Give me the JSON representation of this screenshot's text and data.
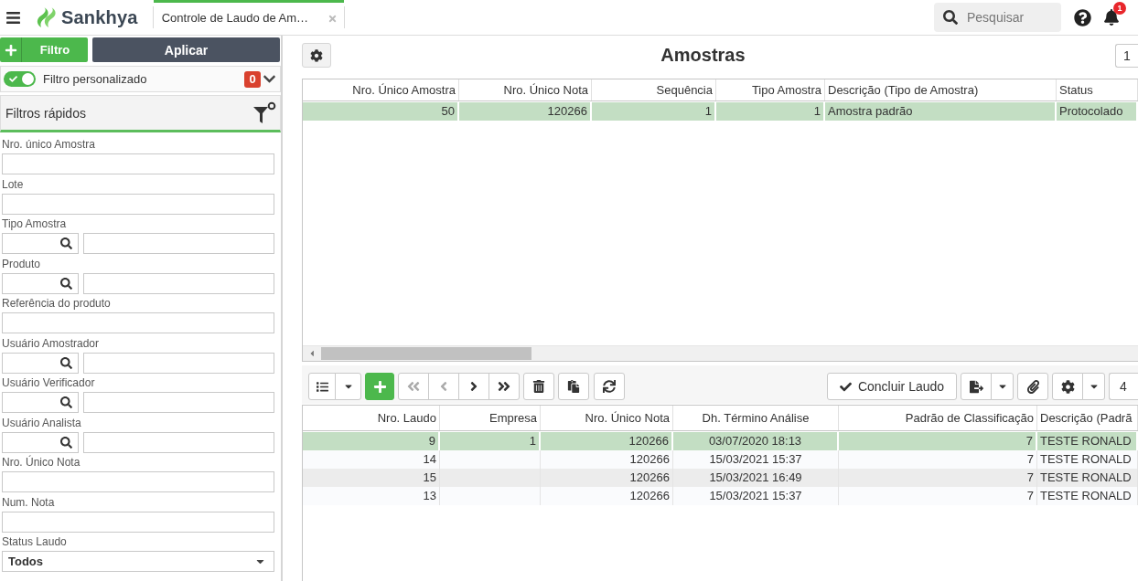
{
  "top_bar": {
    "logo": "Sankhya",
    "tab": {
      "label": "Controle de Laudo de Am…",
      "selected": true
    },
    "search": {
      "placeholder": "Pesquisar"
    },
    "notifications": {
      "count": "1"
    }
  },
  "filter_panel": {
    "add_button": "Filtro",
    "apply_button": "Aplicar",
    "custom_filter": {
      "label": "Filtro personalizado",
      "on": true,
      "count": "0"
    },
    "quick_filters": {
      "title": "Filtros rápidos",
      "fields": [
        {
          "label": "Nro. único Amostra",
          "kind": "text"
        },
        {
          "label": "Lote",
          "kind": "text"
        },
        {
          "label": "Tipo Amostra",
          "kind": "lookup"
        },
        {
          "label": "Produto",
          "kind": "lookup"
        },
        {
          "label": "Referência do produto",
          "kind": "text"
        },
        {
          "label": "Usuário Amostrador",
          "kind": "lookup"
        },
        {
          "label": "Usuário Verificador",
          "kind": "lookup"
        },
        {
          "label": "Usuário Analista",
          "kind": "lookup"
        },
        {
          "label": "Nro. Único Nota",
          "kind": "text"
        },
        {
          "label": "Num. Nota",
          "kind": "text"
        },
        {
          "label": "Status Laudo",
          "kind": "select",
          "value": "Todos"
        }
      ]
    }
  },
  "samples": {
    "title": "Amostras",
    "page": "1",
    "table": {
      "columns": [
        {
          "label": "Nro. Único Amostra",
          "kind": "number"
        },
        {
          "label": "Nro. Único Nota",
          "kind": "number"
        },
        {
          "label": "Sequência",
          "kind": "number"
        },
        {
          "label": "Tipo Amostra",
          "kind": "number"
        },
        {
          "label": "Descrição (Tipo de Amostra)",
          "kind": "text"
        },
        {
          "label": "Status",
          "kind": "text"
        }
      ],
      "rows": [
        {
          "selected": true,
          "cells": [
            "50",
            "120266",
            "1",
            "1",
            "Amostra padrão",
            "Protocolado"
          ]
        }
      ]
    }
  },
  "reports": {
    "toolbar": {
      "nav_buttons": [
        {
          "kind": "first",
          "disabled": true
        },
        {
          "kind": "previous",
          "disabled": true
        },
        {
          "kind": "next",
          "disabled": false
        },
        {
          "kind": "last",
          "disabled": false
        }
      ],
      "complete_button": "Concluir Laudo"
    },
    "page": "4",
    "table": {
      "columns": [
        {
          "label": "Nro. Laudo",
          "kind": "number"
        },
        {
          "label": "Empresa",
          "kind": "number"
        },
        {
          "label": "Nro. Único Nota",
          "kind": "number"
        },
        {
          "label": "Dh. Término Análise",
          "kind": "date"
        },
        {
          "label": "Padrão de Classificação",
          "kind": "number"
        },
        {
          "label": "Descrição (Padrã",
          "kind": "text"
        }
      ],
      "rows": [
        {
          "selected": true,
          "cells": [
            "9",
            "1",
            "120266",
            "03/07/2020 18:13",
            "7",
            "TESTE RONALD"
          ]
        },
        {
          "selected": false,
          "cells": [
            "14",
            null,
            "120266",
            "15/03/2021 15:37",
            "7",
            "TESTE RONALD"
          ]
        },
        {
          "selected": false,
          "cells": [
            "15",
            null,
            "120266",
            "15/03/2021 16:49",
            "7",
            "TESTE RONALD"
          ]
        },
        {
          "selected": false,
          "cells": [
            "13",
            null,
            "120266",
            "15/03/2021 15:37",
            "7",
            "TESTE RONALD"
          ]
        }
      ]
    }
  }
}
